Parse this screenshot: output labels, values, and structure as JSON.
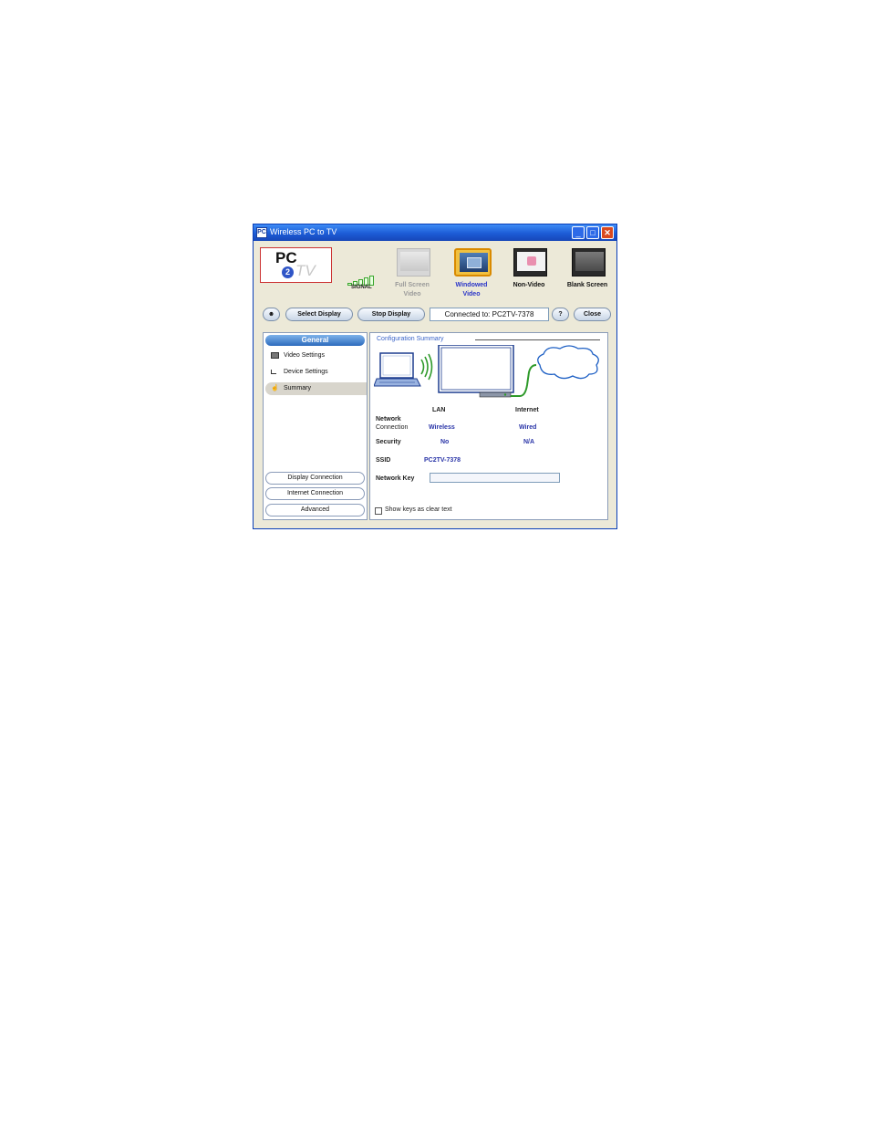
{
  "window": {
    "title": "Wireless PC to TV",
    "icon": "app-icon",
    "controls": [
      "minimize",
      "maximize",
      "close"
    ]
  },
  "logo": {
    "pc": "PC",
    "two": "2",
    "tv": "TV"
  },
  "signal": {
    "label": "SIGNAL",
    "bars_lit": 5
  },
  "modes": [
    {
      "key": "full",
      "label": "Full Screen Video",
      "line1": "Full Screen",
      "line2": "Video",
      "state": "disabled",
      "color": "#9a9a9a"
    },
    {
      "key": "windowed",
      "label": "Windowed Video",
      "line1": "Windowed",
      "line2": "Video",
      "state": "selected",
      "color": "#2a35c8"
    },
    {
      "key": "nonvideo",
      "label": "Non-Video",
      "line1": "Non-Video",
      "line2": "",
      "state": "normal",
      "color": "#111111"
    },
    {
      "key": "blank",
      "label": "Blank Screen",
      "line1": "Blank Screen",
      "line2": "",
      "state": "normal",
      "color": "#111111"
    }
  ],
  "toolbar": {
    "select_display": "Select Display",
    "stop_display": "Stop Display",
    "connected": "Connected to: PC2TV-7378",
    "help": "?",
    "close": "Close"
  },
  "sidebar": {
    "header": "General",
    "items": [
      {
        "label": "Video Settings",
        "icon": "video-settings-icon",
        "selected": false
      },
      {
        "label": "Device Settings",
        "icon": "device-settings-icon",
        "selected": false
      },
      {
        "label": "Summary",
        "icon": "summary-hand-icon",
        "selected": true
      }
    ],
    "buttons": [
      "Display Connection",
      "Internet Connection",
      "Advanced"
    ]
  },
  "summary": {
    "title": "Configuration Summary",
    "col_lan": "LAN",
    "col_internet": "Internet",
    "network_connection_label_1": "Network",
    "network_connection_label_2": "Connection",
    "lan_connection": "Wireless",
    "internet_connection": "Wired",
    "security_label": "Security",
    "lan_security": "No",
    "internet_security": "N/A",
    "ssid_label": "SSID",
    "ssid": "PC2TV-7378",
    "network_key_label": "Network Key",
    "network_key_value": "",
    "show_keys_label": "Show keys as clear text",
    "show_keys_checked": false
  },
  "colors": {
    "titlebar": "#1c5bd6",
    "accent_blue": "#2a35a8",
    "link_blue": "#3a64c8",
    "close_red": "#d9491f",
    "cable_green": "#3e9a2a"
  }
}
